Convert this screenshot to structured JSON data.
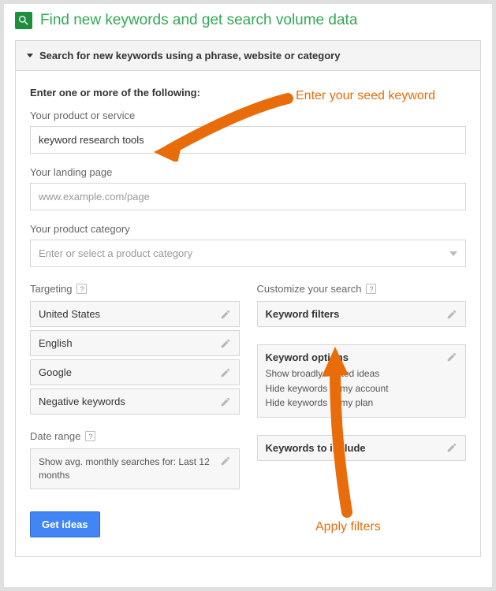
{
  "title": "Find new keywords and get search volume data",
  "accordion_header": "Search for new keywords using a phrase, website or category",
  "intro": "Enter one or more of the following:",
  "annotation_seed": "Enter your seed keyword",
  "annotation_filters": "Apply filters",
  "product": {
    "label": "Your product or service",
    "value": "keyword research tools"
  },
  "landing": {
    "label": "Your landing page",
    "placeholder": "www.example.com/page"
  },
  "category": {
    "label": "Your product category",
    "placeholder": "Enter or select a product category"
  },
  "targeting": {
    "label": "Targeting",
    "items": [
      "United States",
      "English",
      "Google",
      "Negative keywords"
    ]
  },
  "date_range": {
    "label": "Date range",
    "text": "Show avg. monthly searches for: Last 12 months"
  },
  "customize": {
    "label": "Customize your search",
    "keyword_filters": "Keyword filters",
    "keyword_options": {
      "title": "Keyword options",
      "lines": [
        "Show broadly related ideas",
        "Hide keywords in my account",
        "Hide keywords in my plan"
      ]
    },
    "keywords_include": "Keywords to include"
  },
  "get_ideas": "Get ideas",
  "colors": {
    "accent": "#e86c0a",
    "primary": "#4285f4",
    "green": "#35a853"
  }
}
